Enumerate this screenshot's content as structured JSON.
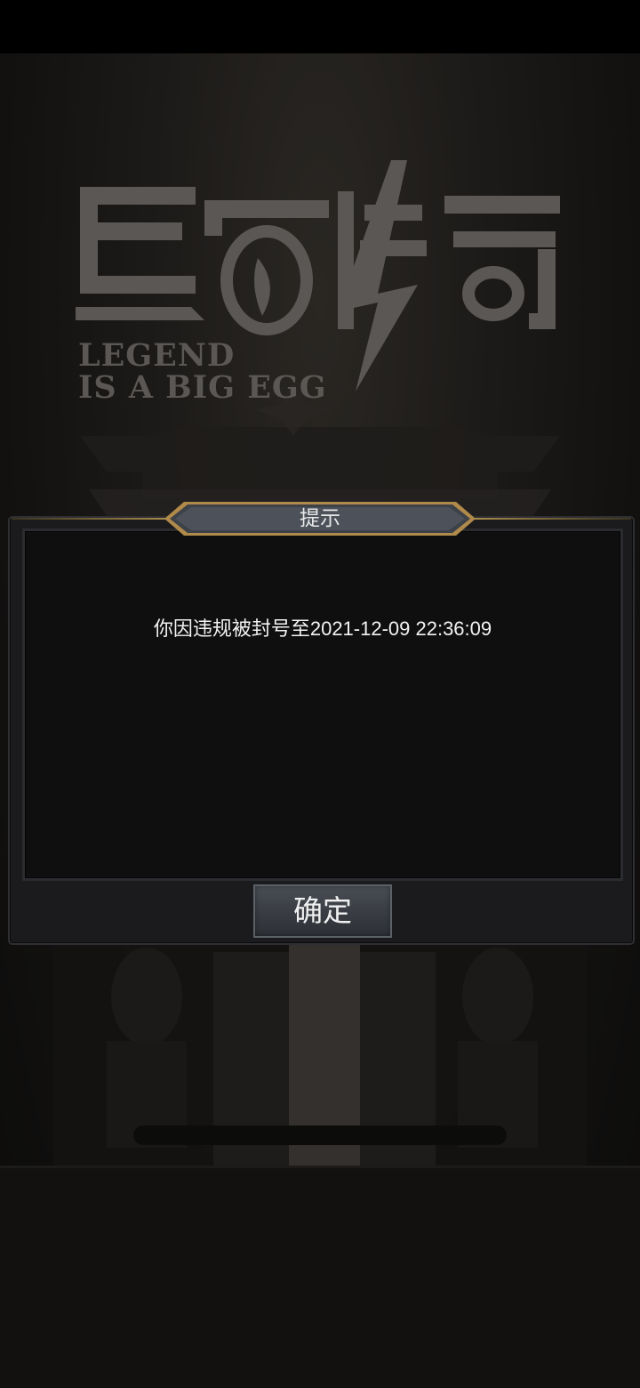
{
  "logo": {
    "title": "蛋蛋传奇",
    "tagline_line1": "LEGEND",
    "tagline_line2": "IS A BIG EGG"
  },
  "dialog": {
    "title": "提示",
    "message": "你因违规被封号至2021-12-09 22:36:09",
    "confirm_label": "确定"
  },
  "colors": {
    "background": "#1d1b19",
    "dialog_bg": "#0f0f10",
    "gold_accent": "#c8a560",
    "logo_gray": "#5a5754",
    "button_bg": "#3a3e44"
  }
}
